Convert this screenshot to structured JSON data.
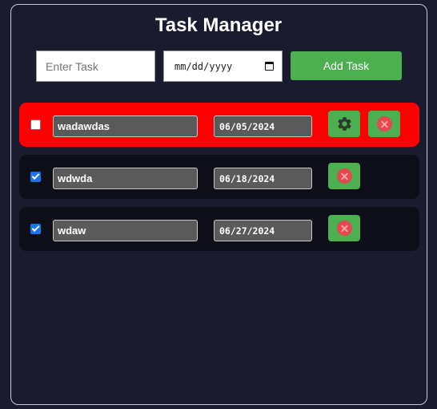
{
  "app": {
    "title": "Task Manager"
  },
  "new_task": {
    "placeholder": "Enter Task",
    "date_placeholder": "mm/dd/yyyy",
    "add_label": "Add Task"
  },
  "colors": {
    "background": "#1b1b2f",
    "accent": "#4caf50",
    "selected_row": "#ff0000",
    "delete_icon": "#e5484d"
  },
  "icons": {
    "settings": "gear-icon",
    "delete": "close-circle-icon",
    "calendar": "calendar-icon"
  },
  "tasks": [
    {
      "name": "wadawdas",
      "date": "06/05/2024",
      "completed": false,
      "highlighted": true
    },
    {
      "name": "wdwda",
      "date": "06/18/2024",
      "completed": true,
      "highlighted": false
    },
    {
      "name": "wdaw",
      "date": "06/27/2024",
      "completed": true,
      "highlighted": false
    }
  ]
}
